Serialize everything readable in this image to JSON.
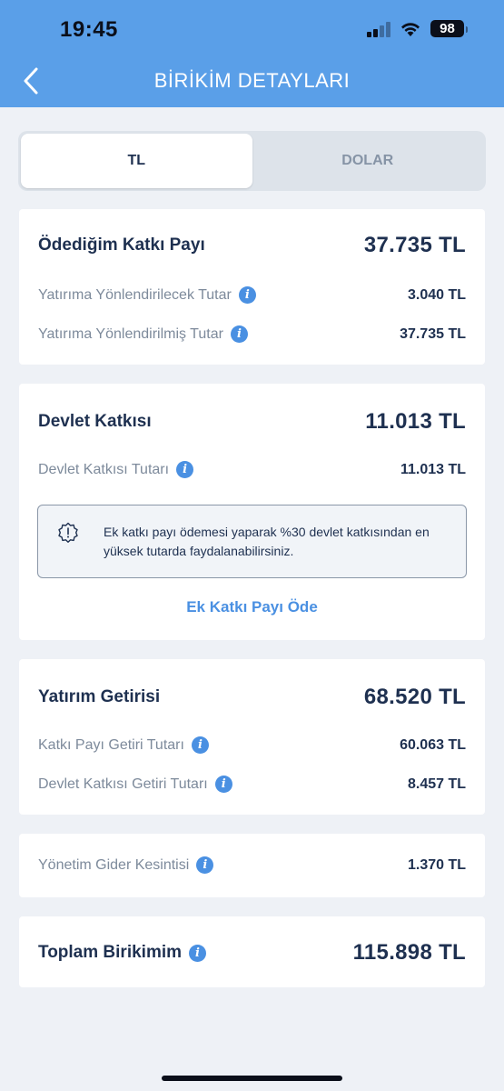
{
  "status_bar": {
    "time": "19:45",
    "battery": "98"
  },
  "header": {
    "title": "BİRİKİM DETAYLARI"
  },
  "tabs": [
    {
      "label": "TL",
      "active": true
    },
    {
      "label": "DOLAR",
      "active": false
    }
  ],
  "contribution": {
    "title": "Ödediğim Katkı Payı",
    "total": "37.735 TL",
    "rows": [
      {
        "label": "Yatırıma Yönlendirilecek Tutar",
        "value": "3.040 TL"
      },
      {
        "label": "Yatırıma Yönlendirilmiş Tutar",
        "value": "37.735 TL"
      }
    ]
  },
  "state": {
    "title": "Devlet Katkısı",
    "total": "11.013 TL",
    "rows": [
      {
        "label": "Devlet Katkısı Tutarı",
        "value": "11.013 TL"
      }
    ],
    "notice": "Ek katkı payı ödemesi yaparak %30 devlet katkısından en yüksek tutarda faydalanabilirsiniz.",
    "link": "Ek Katkı Payı Öde"
  },
  "returns": {
    "title": "Yatırım Getirisi",
    "total": "68.520 TL",
    "rows": [
      {
        "label": "Katkı Payı Getiri Tutarı",
        "value": "60.063 TL"
      },
      {
        "label": "Devlet Katkısı Getiri Tutarı",
        "value": "8.457 TL"
      }
    ]
  },
  "fee": {
    "label": "Yönetim Gider Kesintisi",
    "value": "1.370 TL"
  },
  "total": {
    "label": "Toplam Birikimim",
    "value": "115.898 TL"
  },
  "colors": {
    "header": "#5a9fe8",
    "accent": "#4a90e2",
    "text": "#1e3050",
    "muted": "#7d8a9b",
    "background": "#eef1f6"
  }
}
